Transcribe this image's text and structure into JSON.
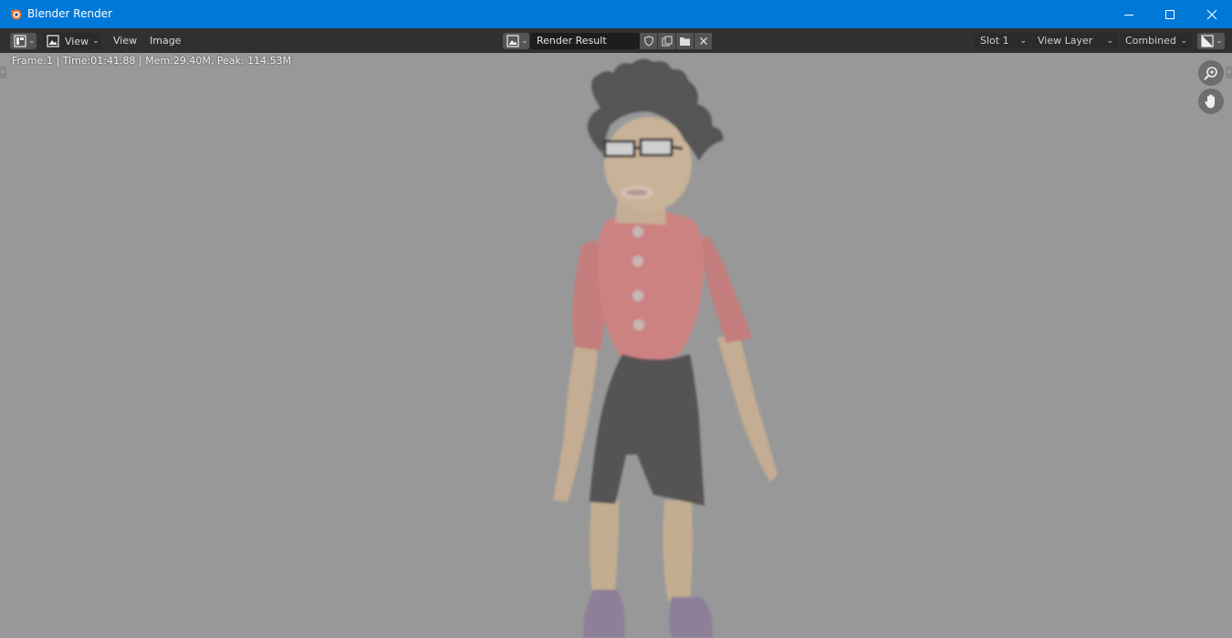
{
  "window": {
    "title": "Blender Render",
    "controls": [
      "minimize-icon",
      "maximize-icon",
      "close-icon"
    ]
  },
  "header": {
    "menus": {
      "view": "View",
      "view_top": "View",
      "image": "Image"
    },
    "image_name": "Render Result",
    "slot": "Slot 1",
    "view_layer": "View Layer",
    "pass": "Combined"
  },
  "viewport": {
    "stats": "Frame:1 | Time:01:41.88 | Mem:29.40M, Peak: 114.53M"
  },
  "colors": {
    "titlebar": "#0078d7",
    "header": "#303030",
    "viewport_bg": "#999899"
  }
}
